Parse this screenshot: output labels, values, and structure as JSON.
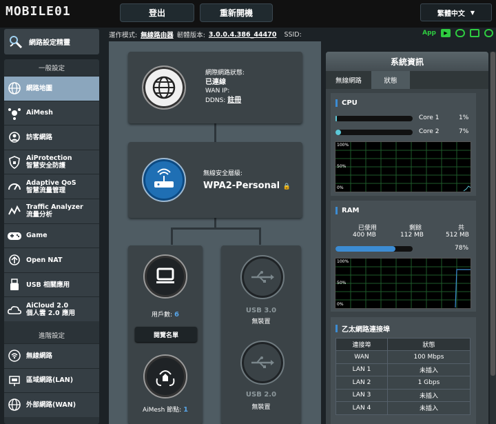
{
  "header": {
    "logo_text": "MOBILE01",
    "logout_label": "登出",
    "reboot_label": "重新開機",
    "language": "繁體中文"
  },
  "infobar": {
    "mode_label": "運作模式:",
    "mode_value": "無線路由器",
    "firmware_label": "韌體版本:",
    "firmware_value": "3.0.0.4.386_44470",
    "ssid_label": "SSID:",
    "app_label": "App"
  },
  "sidebar": {
    "wizard_label": "網路設定精靈",
    "general_header": "一般設定",
    "general_items": [
      {
        "label": "網路地圖",
        "icon": "globe-icon"
      },
      {
        "label": "AiMesh",
        "icon": "mesh-icon"
      },
      {
        "label": "訪客網路",
        "icon": "guest-network-icon"
      },
      {
        "label": "AiProtection",
        "label2": "智慧安全防護",
        "icon": "shield-icon"
      },
      {
        "label": "Adaptive QoS",
        "label2": "智慧流量管理",
        "icon": "qos-icon"
      },
      {
        "label": "Traffic Analyzer",
        "label2": "流量分析",
        "icon": "traffic-icon"
      },
      {
        "label": "Game",
        "icon": "gamepad-icon"
      },
      {
        "label": "Open NAT",
        "icon": "nat-icon"
      },
      {
        "label": "USB 相關應用",
        "icon": "usb-icon"
      },
      {
        "label": "AiCloud 2.0",
        "label2": "個人雲 2.0 應用",
        "icon": "cloud-icon"
      }
    ],
    "advanced_header": "進階設定",
    "advanced_items": [
      {
        "label": "無線網路",
        "icon": "wifi-icon"
      },
      {
        "label": "區域網路(LAN)",
        "icon": "lan-icon"
      },
      {
        "label": "外部網路(WAN)",
        "icon": "wan-icon"
      }
    ]
  },
  "network_map": {
    "internet": {
      "status_label": "網際網路狀態:",
      "status_value": "已連線",
      "wan_ip_label": "WAN IP:",
      "ddns_label": "DDNS:",
      "ddns_value": "註冊"
    },
    "router": {
      "security_label": "無線安全層級:",
      "security_value": "WPA2-Personal"
    },
    "clients": {
      "count_label": "用戶數:",
      "count_value": "6",
      "view_list_label": "閱覽名單"
    },
    "aimesh": {
      "label": "AiMesh 節點:",
      "value": "1"
    },
    "usb3": {
      "label": "USB 3.0",
      "status": "無裝置"
    },
    "usb2": {
      "label": "USB 2.0",
      "status": "無裝置"
    }
  },
  "system_info": {
    "title": "系統資訊",
    "tabs": [
      "無線網路",
      "狀態"
    ],
    "cpu": {
      "title": "CPU",
      "cores": [
        {
          "name": "Core 1",
          "percent": "1%",
          "value": 1
        },
        {
          "name": "Core 2",
          "percent": "7%",
          "value": 7
        }
      ],
      "graph_labels": [
        "100%",
        "50%",
        "0%"
      ]
    },
    "ram": {
      "title": "RAM",
      "used_label": "已使用",
      "free_label": "剩餘",
      "total_label": "共",
      "used_value": "400 MB",
      "free_value": "112 MB",
      "total_value": "512 MB",
      "percent": "78%",
      "value": 78,
      "graph_labels": [
        "100%",
        "50%",
        "0%"
      ]
    },
    "ethernet": {
      "title": "乙太網路連接埠",
      "headers": [
        "連接埠",
        "狀態"
      ],
      "rows": [
        [
          "WAN",
          "100 Mbps"
        ],
        [
          "LAN 1",
          "未插入"
        ],
        [
          "LAN 2",
          "1 Gbps"
        ],
        [
          "LAN 3",
          "未插入"
        ],
        [
          "LAN 4",
          "未插入"
        ]
      ]
    }
  }
}
